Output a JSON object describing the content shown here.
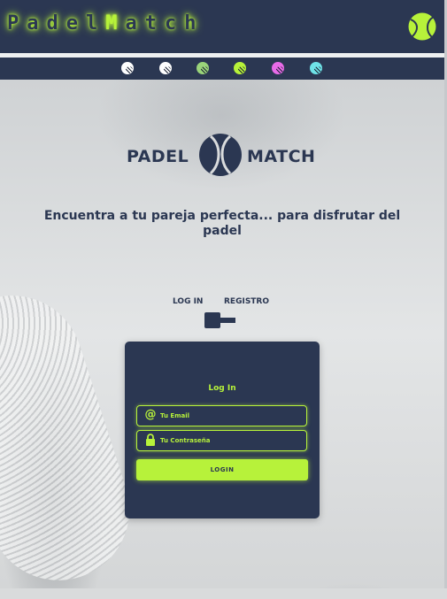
{
  "header": {
    "logo_prefix": "Padel",
    "logo_highlight": "M",
    "logo_suffix": "atch",
    "ball_icon": "tennis-ball-icon",
    "accent_color": "#b7f23a",
    "bar_color": "#2b3752"
  },
  "nav": {
    "dots": [
      {
        "name": "theme-dot-1",
        "color": "#ffffff"
      },
      {
        "name": "theme-dot-2",
        "color": "#ffffff"
      },
      {
        "name": "theme-dot-3",
        "color": "#9ad47a"
      },
      {
        "name": "theme-dot-4",
        "color": "#b7f23a"
      },
      {
        "name": "theme-dot-5",
        "color": "#e86be8"
      },
      {
        "name": "theme-dot-6",
        "color": "#6fe3e8"
      }
    ]
  },
  "brand": {
    "left": "PADEL",
    "right": "MATCH"
  },
  "tagline": "Encuentra a tu pareja perfecta... para disfrutar del padel",
  "tabs": {
    "login": "LOG IN",
    "register": "REGISTRO"
  },
  "login_form": {
    "title": "Log In",
    "email_placeholder": "Tu Email",
    "password_placeholder": "Tu Contraseña",
    "email_icon": "at-icon",
    "password_icon": "lock-icon",
    "submit_label": "LOGIN"
  }
}
